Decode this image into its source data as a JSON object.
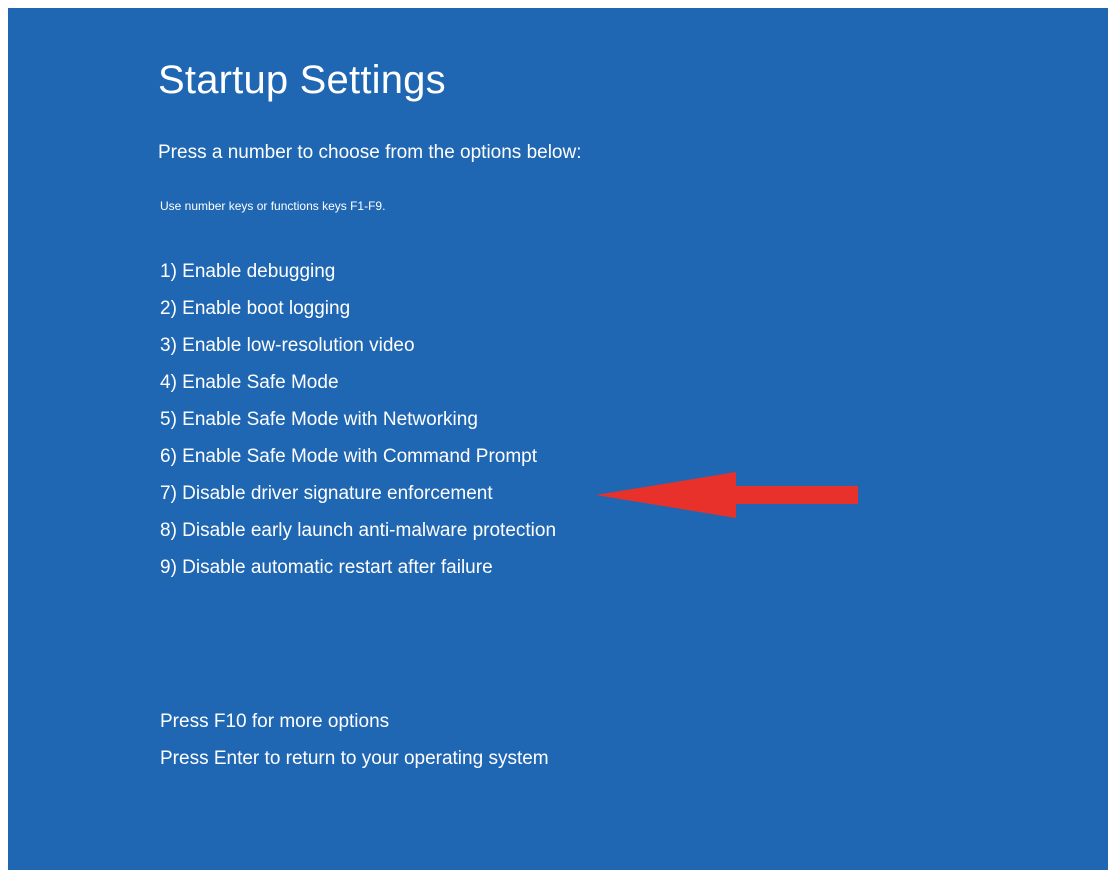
{
  "screen": {
    "title": "Startup Settings",
    "subtitle": "Press a number to choose from the options below:",
    "hint": "Use number keys or functions keys F1-F9.",
    "background_color": "#2067b3",
    "text_color": "#ffffff"
  },
  "options": [
    {
      "label": "1) Enable debugging"
    },
    {
      "label": "2) Enable boot logging"
    },
    {
      "label": "3) Enable low-resolution video"
    },
    {
      "label": "4) Enable Safe Mode"
    },
    {
      "label": "5) Enable Safe Mode with Networking"
    },
    {
      "label": "6) Enable Safe Mode with Command Prompt"
    },
    {
      "label": "7) Disable driver signature enforcement"
    },
    {
      "label": "8) Disable early launch anti-malware protection"
    },
    {
      "label": "9) Disable automatic restart after failure"
    }
  ],
  "footer": {
    "more_options": "Press F10 for more options",
    "return": "Press Enter to return to your operating system"
  },
  "annotation": {
    "icon": "red-arrow-icon",
    "color": "#e8312a",
    "points_to_option": 7
  }
}
